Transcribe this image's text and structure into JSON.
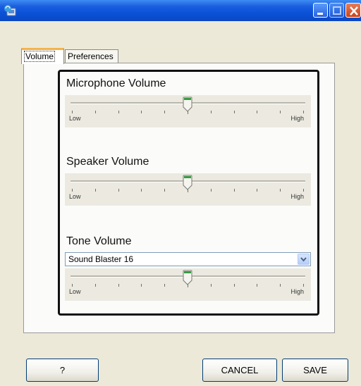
{
  "window": {
    "title": ""
  },
  "tabs": [
    {
      "label": "Volume",
      "selected": true
    },
    {
      "label": "Preferences",
      "selected": false
    }
  ],
  "microphone": {
    "title": "Microphone Volume",
    "low_label": "Low",
    "high_label": "High",
    "level_percent": 50
  },
  "speaker": {
    "title": "Speaker Volume",
    "low_label": "Low",
    "high_label": "High",
    "level_percent": 50
  },
  "tone": {
    "title": "Tone Volume",
    "device": "Sound Blaster 16",
    "low_label": "Low",
    "high_label": "High",
    "level_percent": 50
  },
  "buttons": {
    "help": "?",
    "cancel": "CANCEL",
    "save": "SAVE"
  },
  "colors": {
    "titlebar": "#0a52d8",
    "tab_accent": "#f4b24a",
    "dialog_bg": "#ece9d8",
    "thumb_accent": "#3a9a45"
  }
}
